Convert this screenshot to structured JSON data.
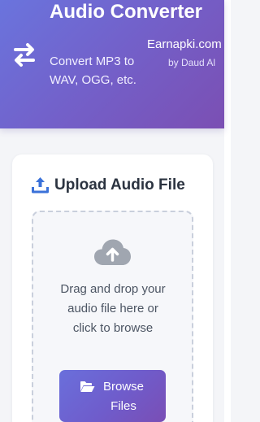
{
  "header": {
    "title": "Audio Converter",
    "subtitle": "Convert MP3 to WAV, OGG, etc.",
    "site_name": "Earnapki.com",
    "site_author": "by Daud Al",
    "icon": "swap-arrows-icon"
  },
  "upload": {
    "title": "Upload Audio File",
    "title_icon": "upload-icon",
    "dropzone_icon": "cloud-upload-icon",
    "dropzone_text": "Drag and drop your audio file here or click to browse",
    "browse_label": "Browse Files",
    "browse_icon": "folder-open-icon"
  },
  "colors": {
    "header_gradient_start": "#6a74dd",
    "header_gradient_end": "#7b4fb3",
    "accent_blue": "#3b72d9",
    "page_background": "#f4f5f8",
    "dropzone_border": "#c9cfdc",
    "cloud_icon": "#a0a6b0"
  }
}
